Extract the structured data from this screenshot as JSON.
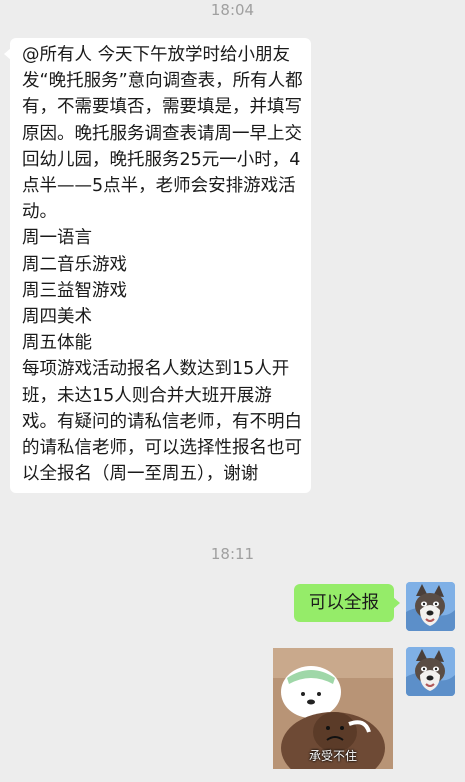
{
  "chat": {
    "timestamp_1": "18:04",
    "timestamp_2": "18:11",
    "incoming_message": "@所有人 今天下午放学时给小朋友发“晚托服务”意向调查表，所有人都有，不需要填否，需要填是，并填写原因。晚托服务调查表请周一早上交回幼儿园，晚托服务25元一小时，4点半——5点半，老师会安排游戏活动。\n周一语言\n周二音乐游戏\n周三益智游戏\n周四美术\n周五体能\n每项游戏活动报名人数达到15人开班，未达15人则合并大班开展游戏。有疑问的请私信老师，有不明白的请私信老师，可以选择性报名也可以全报名（周一至周五），谢谢",
    "outgoing_message": "可以全报",
    "sticker_caption": "承受不住"
  },
  "colors": {
    "background": "#ededed",
    "incoming_bubble": "#ffffff",
    "outgoing_bubble": "#95ec69",
    "timestamp_text": "#a0a0a0"
  },
  "icons": {
    "avatar": "husky-dog-avatar",
    "sticker": "bear-sticker"
  }
}
